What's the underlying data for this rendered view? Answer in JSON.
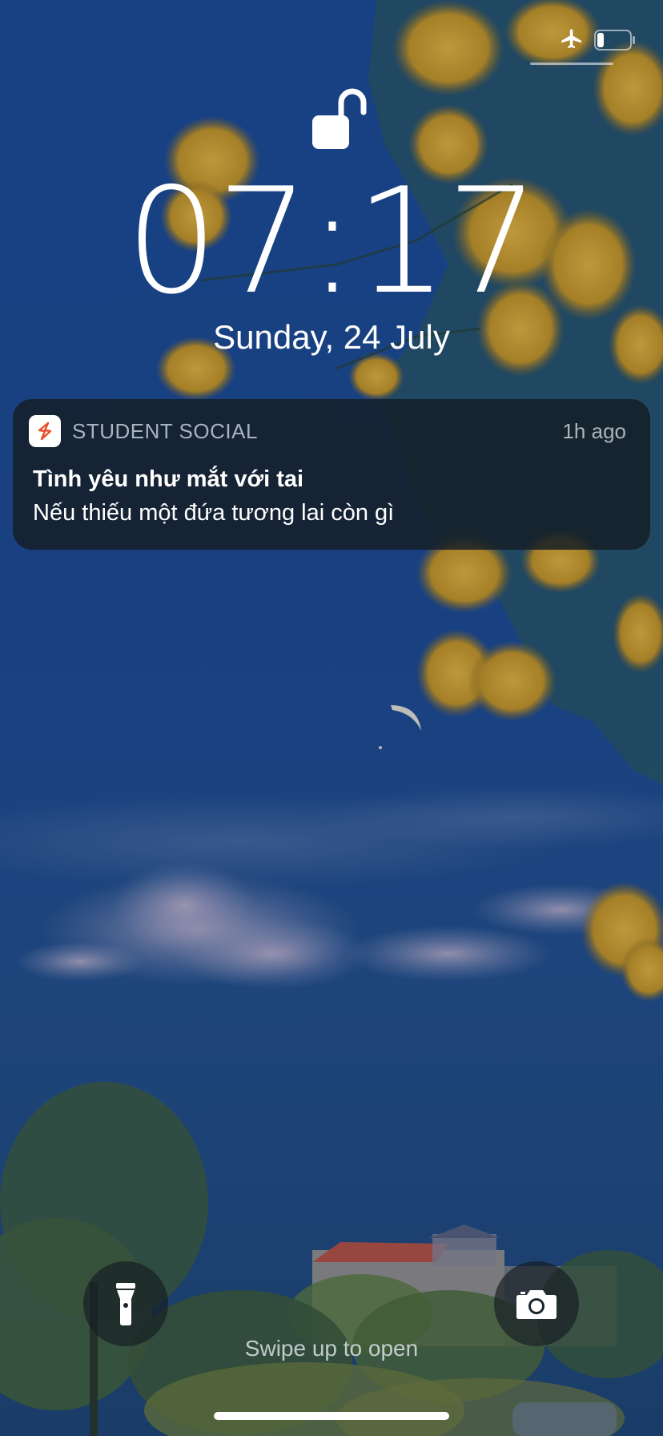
{
  "status_bar": {
    "airplane_icon": "airplane-icon",
    "battery_icon": "battery-icon",
    "battery_level": 0.2
  },
  "lock": {
    "icon": "unlocked-padlock-icon"
  },
  "clock": {
    "time": "07:17",
    "date": "Sunday, 24 July"
  },
  "notification": {
    "app_name": "STUDENT SOCIAL",
    "app_icon": "student-social-app-icon",
    "time": "1h ago",
    "title": "Tình yêu như mắt với tai",
    "body": "Nếu thiếu một đứa tương lai còn gì",
    "accent_color": "#e8502a"
  },
  "bottom": {
    "flashlight_icon": "flashlight-icon",
    "camera_icon": "camera-icon",
    "swipe_hint": "Swipe up to open"
  },
  "colors": {
    "sky_top": "#1d4a91",
    "sky_bottom": "#1f4a7a",
    "flowers": "#d4a22a",
    "notification_bg": "#141e26"
  }
}
